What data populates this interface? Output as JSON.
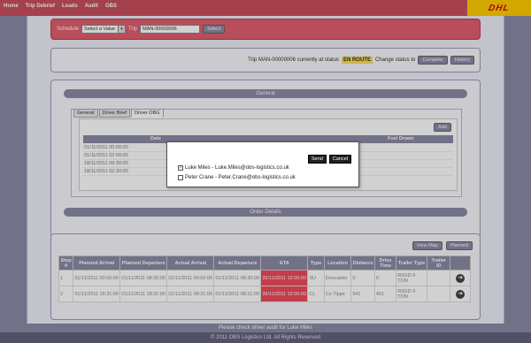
{
  "nav": [
    "Home",
    "Trip Debrief",
    "Loads",
    "Audit",
    "OBS"
  ],
  "logo_text": "DHL",
  "schedule": {
    "label": "Schedule",
    "select_value": "Select a Value",
    "trip_label": "Trip",
    "trip_value": "MAN-00000006",
    "button": "Select"
  },
  "status_bar": {
    "text": "Trip MAN-00000006 currently at status",
    "status": "EN ROUTE",
    "change_text": "Change status to",
    "complete_btn": "Complete",
    "history_btn": "History"
  },
  "general_bar": "General",
  "tabs": [
    "General",
    "Driver Brief",
    "Driver OBG"
  ],
  "add_btn": "Add",
  "grid": {
    "headers": [
      "Date",
      "Fuel Drawn"
    ],
    "rows": [
      "01/11/2011 00:00:00",
      "01/11/2011 02:00:00",
      "18/11/2011 09:30:00",
      "18/11/2011 02:30:00"
    ]
  },
  "order_details_bar": "Order Details",
  "table": {
    "view_map": "View Map",
    "planned": "Planned",
    "headers": [
      "Stop #",
      "Planned Arrival",
      "Planned Departure",
      "Actual Arrival",
      "Actual Departure",
      "ETA",
      "Type",
      "Location",
      "Distance",
      "Drive Time",
      "Trailer Type",
      "Trailer ID",
      ""
    ],
    "rows": [
      [
        "1",
        "01/11/2011 00:00:00",
        "01/11/2011 08:30:00",
        "01/11/2011 00:00:00",
        "01/11/2011 08:30:00",
        "26/11/2011 12:00:00",
        "SU",
        "Doncaster",
        "0",
        "0",
        "RIGID 9 TON",
        ""
      ],
      [
        "2",
        "01/11/2011 18:31:00",
        "01/11/2011 18:31:00",
        "01/11/2011 08:31:00",
        "01/11/2011 08:31:00",
        "26/11/2011 12:00:00",
        "CL",
        "Co Tippe",
        "541",
        "451",
        "RIGID 9 TON",
        ""
      ]
    ]
  },
  "notice": "Please check driver audit for Luke Miles",
  "footer": "© 2011 OBS Logistics Ltd. All Rights Reserved",
  "modal": {
    "send": "Send",
    "cancel": "Cancel",
    "options": [
      {
        "label": "Luke Miles - Luke.Miles@obs-logistics.co.uk",
        "checked": true
      },
      {
        "label": "Peter Crane - Peter.Crane@obs-logistics.co.uk",
        "checked": false
      }
    ]
  },
  "colors": {
    "header": "#c8505d",
    "accent": "#8a8aa6",
    "eta": "#ef4a5a",
    "status": "#ffdd55"
  }
}
